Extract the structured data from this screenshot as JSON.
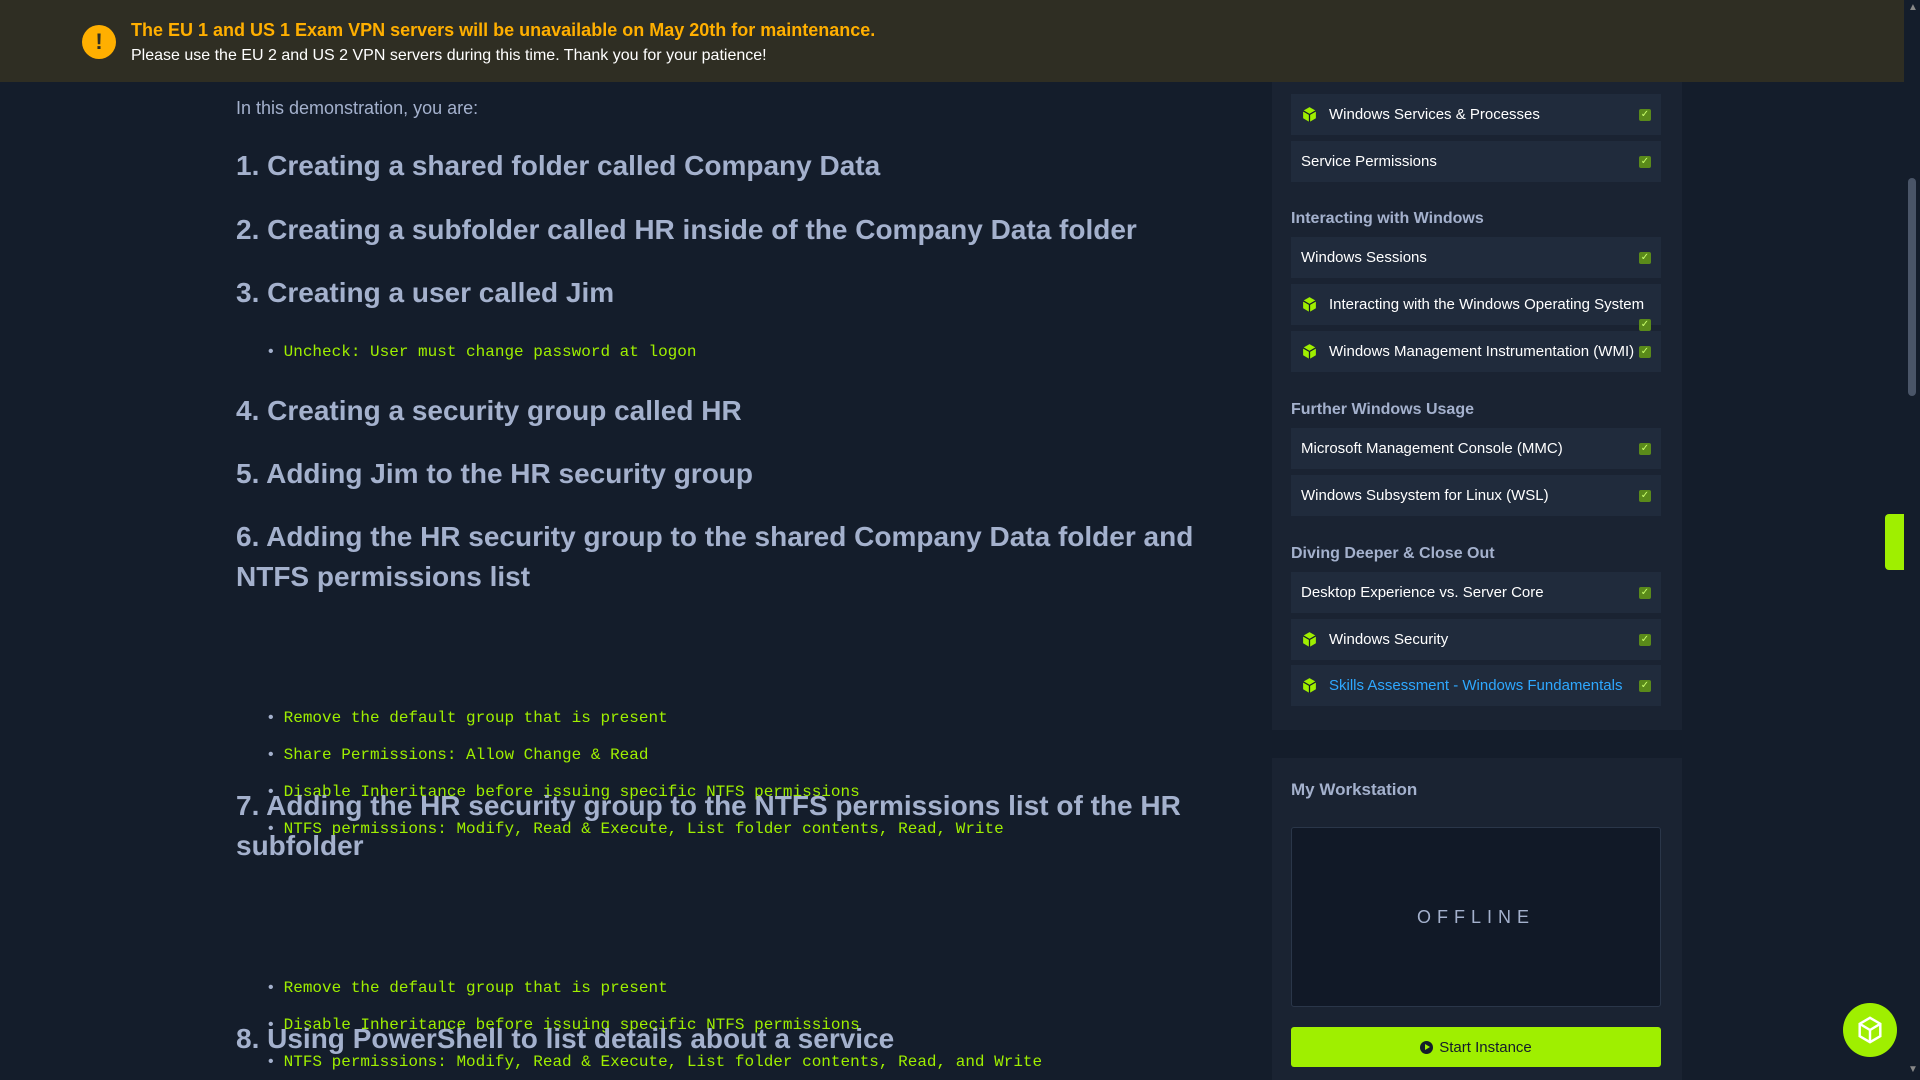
{
  "banner": {
    "title": "The EU 1 and US 1 Exam VPN servers will be unavailable on May 20th for maintenance.",
    "subtitle": "Please use the EU 2 and US 2 VPN servers during this time. Thank you for your patience!",
    "color_warning": "#ffaf00"
  },
  "content": {
    "intro": "In this demonstration, you are:",
    "steps": [
      {
        "title": "1. Creating a shared folder called Company Data",
        "bullets": []
      },
      {
        "title": "2. Creating a subfolder called HR inside of the Company Data folder",
        "bullets": []
      },
      {
        "title": "3. Creating a user called Jim",
        "bullets": [
          "Uncheck: User must change password at logon"
        ]
      },
      {
        "title": "4. Creating a security group called HR",
        "bullets": []
      },
      {
        "title": "5. Adding Jim to the HR security group",
        "bullets": []
      },
      {
        "title": "6. Adding the HR security group to the shared Company Data folder and NTFS permissions list",
        "bullets": [
          "Remove the default group that is present",
          "Share Permissions: Allow Change & Read",
          "Disable Inheritance before issuing specific NTFS permissions",
          "NTFS permissions: Modify, Read & Execute, List folder contents, Read, Write"
        ]
      },
      {
        "title": "7. Adding the HR security group to the NTFS permissions list of the HR subfolder",
        "bullets": [
          "Remove the default group that is present",
          "Disable Inheritance before issuing specific NTFS permissions",
          "NTFS permissions: Modify, Read & Execute, List folder contents, Read, and Write"
        ]
      },
      {
        "title": "8. Using PowerShell to list details about a service",
        "bullets": []
      }
    ]
  },
  "sidebar": {
    "items_top": [
      {
        "label": "Windows Services & Processes",
        "icon": "cube-icon",
        "done": true
      },
      {
        "label": "Service Permissions",
        "icon": "",
        "done": true
      }
    ],
    "groups": [
      {
        "label": "Interacting with Windows",
        "items": [
          {
            "label": "Windows Sessions",
            "icon": "",
            "done": true
          },
          {
            "label": "Interacting with the Windows Operating System",
            "icon": "cube-icon",
            "done": true
          },
          {
            "label": "Windows Management Instrumentation (WMI)",
            "icon": "cube-icon",
            "done": true
          }
        ]
      },
      {
        "label": "Further Windows Usage",
        "items": [
          {
            "label": "Microsoft Management Console (MMC)",
            "icon": "",
            "done": true
          },
          {
            "label": "Windows Subsystem for Linux (WSL)",
            "icon": "",
            "done": true
          }
        ]
      },
      {
        "label": "Diving Deeper & Close Out",
        "items": [
          {
            "label": "Desktop Experience vs. Server Core",
            "icon": "",
            "done": true
          },
          {
            "label": "Windows Security",
            "icon": "cube-icon",
            "done": true
          },
          {
            "label": "Skills Assessment - Windows Fundamentals",
            "icon": "cube-icon",
            "done": true,
            "active": true
          }
        ]
      }
    ]
  },
  "workstation": {
    "title": "My Workstation",
    "status": "OFFLINE",
    "start_label": "Start Instance"
  },
  "colors": {
    "background": "#141d2b",
    "accent": "#9fef00",
    "link": "#2ea8ff"
  }
}
